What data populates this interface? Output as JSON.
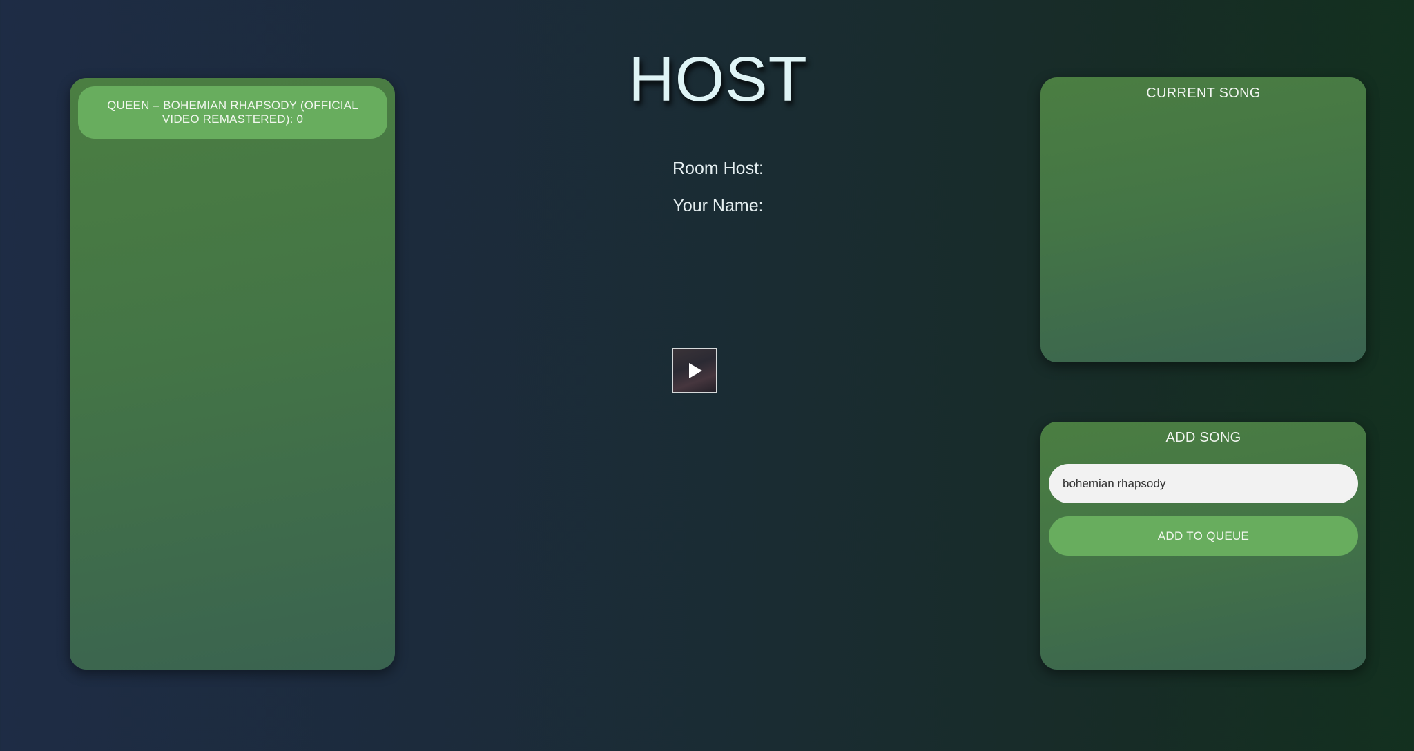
{
  "page": {
    "title": "HOST",
    "room_host_label": "Room Host:",
    "your_name_label": "Your Name:"
  },
  "queue": {
    "items": [
      {
        "label": "QUEEN – BOHEMIAN RHAPSODY (OFFICIAL VIDEO REMASTERED): 0"
      }
    ]
  },
  "current_song": {
    "title": "CURRENT SONG"
  },
  "video": {
    "icon": "play-icon"
  },
  "add_song": {
    "title": "ADD SONG",
    "input_value": "bohemian rhapsody",
    "button_label": "ADD TO QUEUE"
  },
  "colors": {
    "panel_green": "#4b7e42",
    "accent_green": "#68ad5e",
    "background_dark": "#1c2b3c",
    "title_text": "#dff4f6"
  }
}
